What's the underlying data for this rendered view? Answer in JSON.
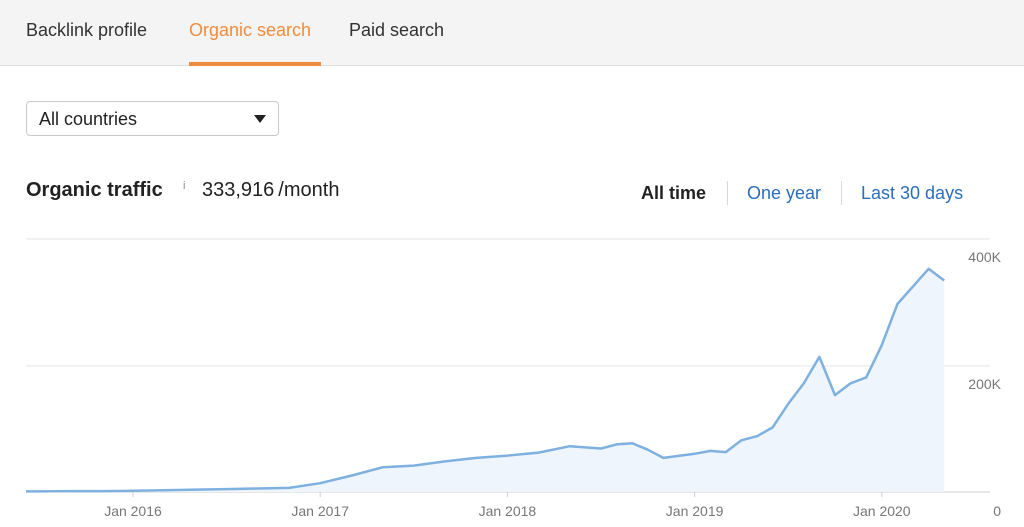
{
  "tabs": [
    {
      "label": "Backlink profile",
      "active": false
    },
    {
      "label": "Organic search",
      "active": true
    },
    {
      "label": "Paid search",
      "active": false
    }
  ],
  "country_select": {
    "value": "All countries",
    "icon": "caret-down-icon"
  },
  "traffic": {
    "title": "Organic traffic",
    "info_mark": "i",
    "value": "333,916",
    "unit": "/month"
  },
  "time_ranges": [
    {
      "label": "All time",
      "active": true
    },
    {
      "label": "One year",
      "active": false
    },
    {
      "label": "Last 30 days",
      "active": false
    }
  ],
  "colors": {
    "accent": "#ef8c3d",
    "link": "#2a6ebb",
    "line": "#7eb0e0",
    "area": "#eef5fc"
  },
  "chart_data": {
    "type": "area",
    "x_tick_labels": [
      "Jan 2016",
      "Jan 2017",
      "Jan 2018",
      "Jan 2019",
      "Jan 2020"
    ],
    "y_tick_labels": [
      "400K",
      "200K",
      "0"
    ],
    "ylim": [
      0,
      400000
    ],
    "grid": true,
    "series": [
      {
        "x": [
          "2015-05",
          "2015-07",
          "2015-09",
          "2015-11",
          "2016-01",
          "2016-03",
          "2016-05",
          "2016-07",
          "2016-09",
          "2016-11",
          "2017-01",
          "2017-03",
          "2017-05",
          "2017-07",
          "2017-09",
          "2017-11",
          "2018-01",
          "2018-03",
          "2018-05",
          "2018-07",
          "2018-08",
          "2018-09",
          "2018-10",
          "2018-11",
          "2019-01",
          "2019-02",
          "2019-03",
          "2019-04",
          "2019-05",
          "2019-06",
          "2019-07",
          "2019-08",
          "2019-09",
          "2019-10",
          "2019-11",
          "2019-12",
          "2020-01",
          "2020-02",
          "2020-03",
          "2020-04",
          "2020-05"
        ],
        "values": [
          1000,
          1000,
          1500,
          1500,
          2000,
          3000,
          4000,
          5000,
          6000,
          7000,
          15000,
          28000,
          42000,
          45000,
          52000,
          58000,
          62000,
          67000,
          78000,
          74000,
          81000,
          83000,
          72000,
          58000,
          65000,
          70000,
          68000,
          88000,
          95000,
          110000,
          150000,
          185000,
          230000,
          165000,
          185000,
          195000,
          250000,
          320000,
          350000,
          380000,
          360000
        ]
      }
    ]
  }
}
